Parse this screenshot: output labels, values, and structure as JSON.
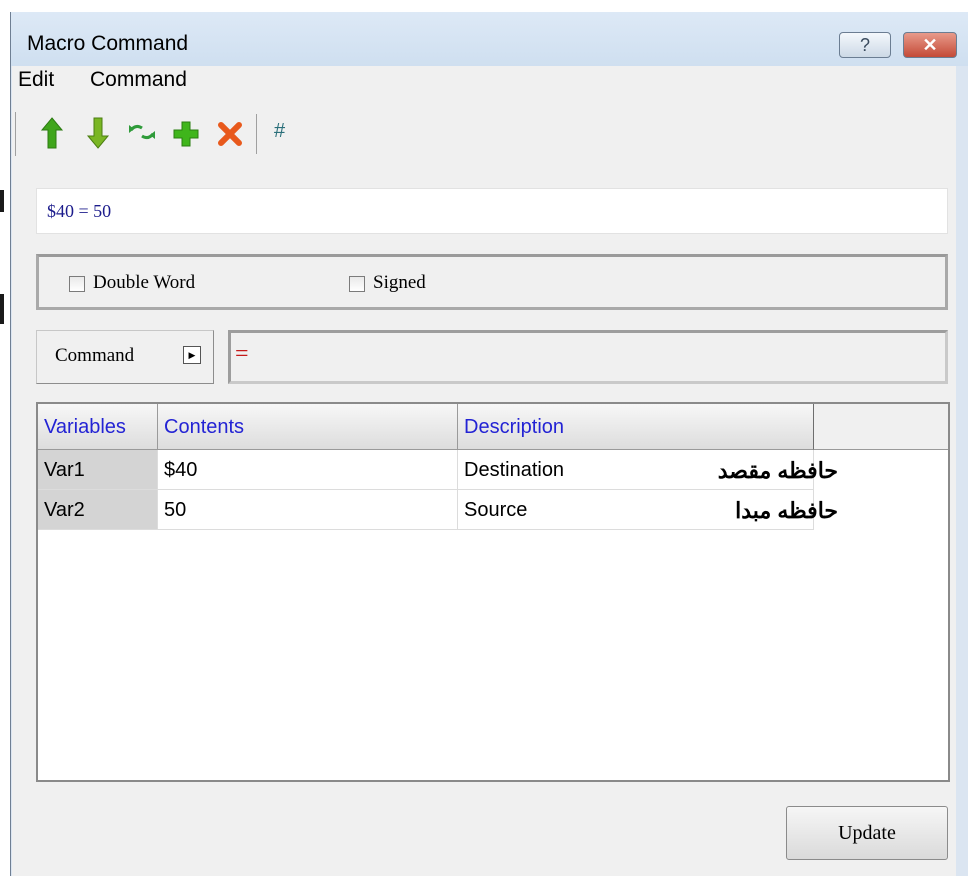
{
  "window": {
    "title": "Macro Command",
    "help_glyph": "?",
    "close_glyph": "✕"
  },
  "menu": [
    "Edit",
    "Command"
  ],
  "toolbar": {
    "icons": [
      "move-up-icon",
      "move-down-icon",
      "swap-icon",
      "add-icon",
      "delete-icon",
      "number-sign-icon"
    ],
    "hash_label": "#",
    "colors": {
      "green": "#3fa51b",
      "orange": "#e8591c",
      "teal": "#2a6f7a"
    }
  },
  "expression": "$40 = 50",
  "options": {
    "double_word": "Double Word",
    "signed": "Signed"
  },
  "command": {
    "label": "Command",
    "value": "="
  },
  "grid": {
    "headers": [
      "Variables",
      "Contents",
      "Description"
    ],
    "rows": [
      {
        "var": "Var1",
        "contents": "$40",
        "description": "Destination",
        "note": "حافظه مقصد"
      },
      {
        "var": "Var2",
        "contents": "50",
        "description": "Source",
        "note": "حافظه مبدا"
      }
    ]
  },
  "update_label": "Update"
}
